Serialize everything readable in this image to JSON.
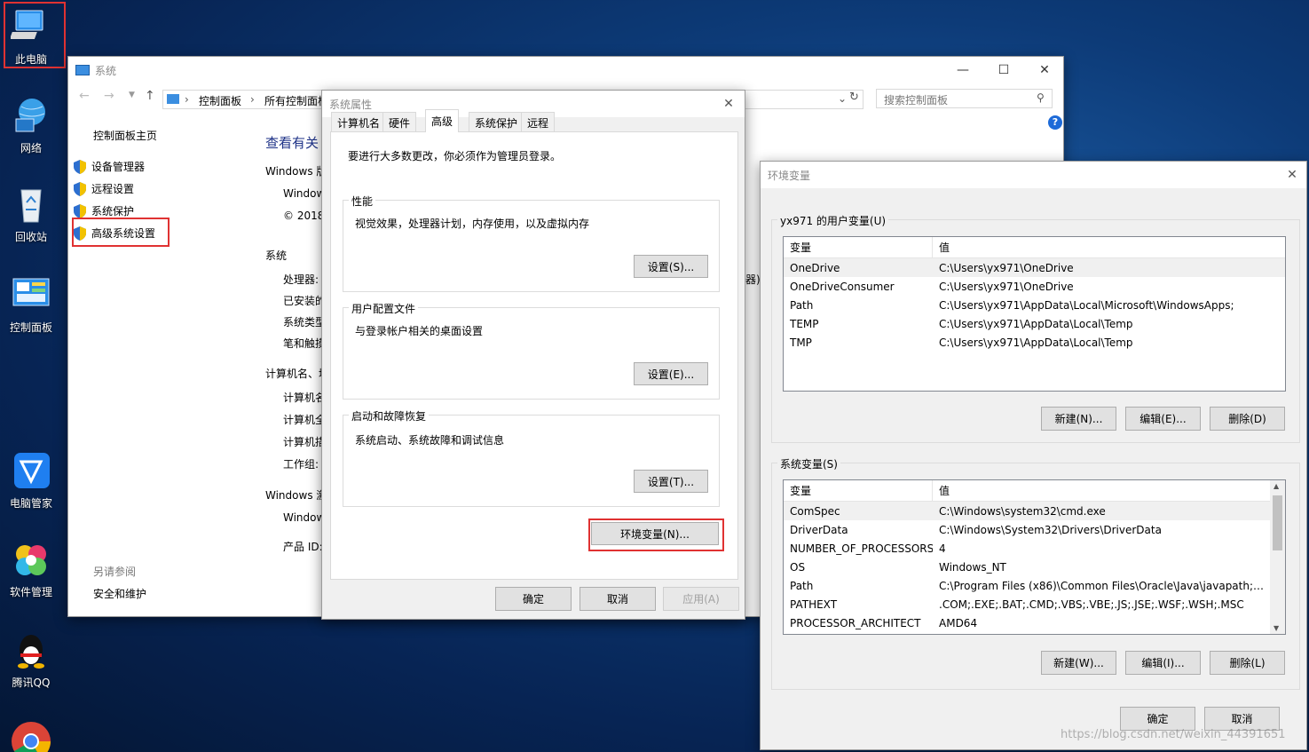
{
  "desktop": {
    "icons": [
      {
        "label": "此电脑"
      },
      {
        "label": "网络"
      },
      {
        "label": "回收站"
      },
      {
        "label": "控制面板"
      },
      {
        "label": "电脑管家"
      },
      {
        "label": "软件管理"
      },
      {
        "label": "腾讯QQ"
      }
    ]
  },
  "system_window": {
    "title": "系统",
    "breadcrumb": [
      "控制面板",
      "所有控制面板"
    ],
    "search_placeholder": "搜索控制面板",
    "sidebar_home": "控制面板主页",
    "sidebar_links": [
      "设备管理器",
      "远程设置",
      "系统保护",
      "高级系统设置"
    ],
    "see_also_title": "另请参阅",
    "see_also_link": "安全和维护",
    "main_heading": "查看有关",
    "content": {
      "edition_label": "Windows 版",
      "edition_value": "Window",
      "copyright": "© 2018",
      "system_label": "系统",
      "processor": "处理器:",
      "installed": "已安装的",
      "system_type": "系统类型",
      "pen_touch": "笔和触摸",
      "computer_name_label": "计算机名、域",
      "comp_name": "计算机名",
      "comp_full": "计算机全",
      "comp_desc": "计算机描",
      "workgroup": "工作组:",
      "activation_label": "Windows 激",
      "activation_value": "Window",
      "product_id": "产品 ID:",
      "partial_right": "器)"
    }
  },
  "sysprops_dialog": {
    "title": "系统属性",
    "tabs": [
      "计算机名",
      "硬件",
      "高级",
      "系统保护",
      "远程"
    ],
    "active_tab": "高级",
    "admin_notice": "要进行大多数更改，你必须作为管理员登录。",
    "groups": [
      {
        "title": "性能",
        "desc": "视觉效果，处理器计划，内存使用，以及虚拟内存",
        "button": "设置(S)..."
      },
      {
        "title": "用户配置文件",
        "desc": "与登录帐户相关的桌面设置",
        "button": "设置(E)..."
      },
      {
        "title": "启动和故障恢复",
        "desc": "系统启动、系统故障和调试信息",
        "button": "设置(T)..."
      }
    ],
    "env_button": "环境变量(N)...",
    "ok": "确定",
    "cancel": "取消",
    "apply": "应用(A)"
  },
  "env_dialog": {
    "title": "环境变量",
    "user_section": "yx971 的用户变量(U)",
    "col_var": "变量",
    "col_val": "值",
    "user_vars": [
      {
        "name": "OneDrive",
        "value": "C:\\Users\\yx971\\OneDrive"
      },
      {
        "name": "OneDriveConsumer",
        "value": "C:\\Users\\yx971\\OneDrive"
      },
      {
        "name": "Path",
        "value": "C:\\Users\\yx971\\AppData\\Local\\Microsoft\\WindowsApps;"
      },
      {
        "name": "TEMP",
        "value": "C:\\Users\\yx971\\AppData\\Local\\Temp"
      },
      {
        "name": "TMP",
        "value": "C:\\Users\\yx971\\AppData\\Local\\Temp"
      }
    ],
    "user_buttons": [
      "新建(N)...",
      "编辑(E)...",
      "删除(D)"
    ],
    "system_section": "系统变量(S)",
    "system_vars": [
      {
        "name": "ComSpec",
        "value": "C:\\Windows\\system32\\cmd.exe"
      },
      {
        "name": "DriverData",
        "value": "C:\\Windows\\System32\\Drivers\\DriverData"
      },
      {
        "name": "NUMBER_OF_PROCESSORS",
        "value": "4"
      },
      {
        "name": "OS",
        "value": "Windows_NT"
      },
      {
        "name": "Path",
        "value": "C:\\Program Files (x86)\\Common Files\\Oracle\\Java\\javapath;C:..."
      },
      {
        "name": "PATHEXT",
        "value": ".COM;.EXE;.BAT;.CMD;.VBS;.VBE;.JS;.JSE;.WSF;.WSH;.MSC"
      },
      {
        "name": "PROCESSOR_ARCHITECT",
        "value": "AMD64"
      }
    ],
    "system_buttons": [
      "新建(W)...",
      "编辑(I)...",
      "删除(L)"
    ],
    "ok": "确定",
    "cancel": "取消"
  },
  "watermark": "https://blog.csdn.net/weixin_44391651"
}
